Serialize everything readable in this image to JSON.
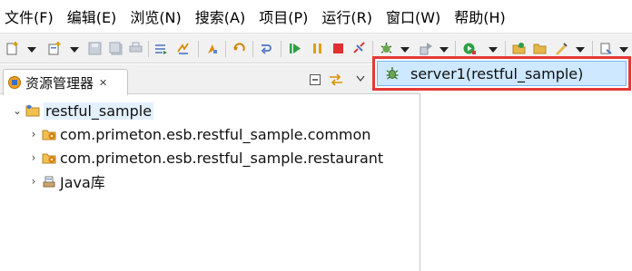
{
  "menu": {
    "items": [
      {
        "label": "文件(F)"
      },
      {
        "label": "编辑(E)"
      },
      {
        "label": "浏览(N)"
      },
      {
        "label": "搜索(A)"
      },
      {
        "label": "项目(P)"
      },
      {
        "label": "运行(R)"
      },
      {
        "label": "窗口(W)"
      },
      {
        "label": "帮助(H)"
      }
    ]
  },
  "panel": {
    "tab_label": "资源管理器",
    "close_glyph": "✕"
  },
  "tree": {
    "root": {
      "label": "restful_sample",
      "expanded": true
    },
    "children": [
      {
        "label": "com.primeton.esb.restful_sample.common"
      },
      {
        "label": "com.primeton.esb.restful_sample.restaurant"
      },
      {
        "label": "Java库"
      }
    ]
  },
  "popup": {
    "item_label": "server1(restful_sample)"
  },
  "colors": {
    "popup_border": "#e53935",
    "popup_selection": "#cde8ff",
    "toolbar_bg": "#f1f1f1"
  }
}
